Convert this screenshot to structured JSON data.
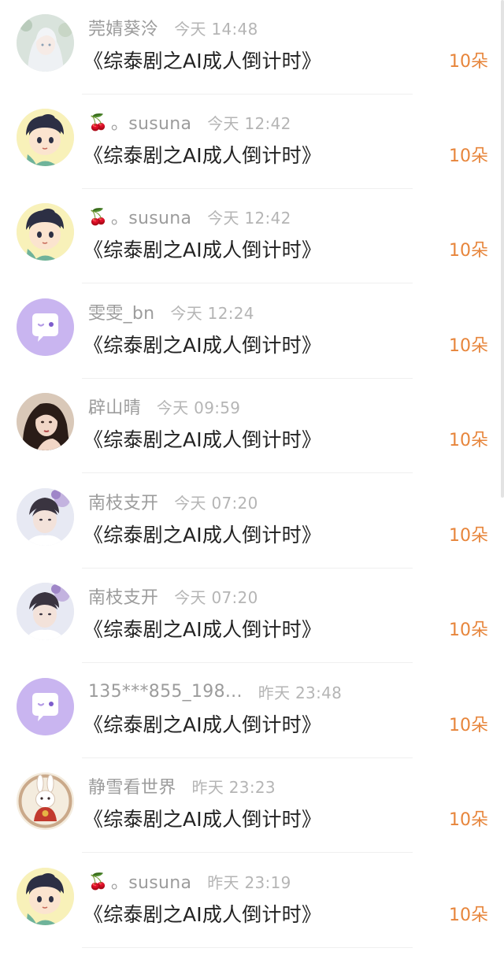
{
  "gift_list": {
    "items": [
      {
        "name": "莞婧葵泠",
        "name_emoji": "",
        "time": "今天 14:48",
        "title": "《综泰剧之AI成人倒计时》",
        "amount": "10朵",
        "avatar": "anime-girl-white-hair"
      },
      {
        "name": "。susuna",
        "name_emoji": "🍒",
        "time": "今天 12:42",
        "title": "《综泰剧之AI成人倒计时》",
        "amount": "10朵",
        "avatar": "cartoon-boy"
      },
      {
        "name": "。susuna",
        "name_emoji": "🍒",
        "time": "今天 12:42",
        "title": "《综泰剧之AI成人倒计时》",
        "amount": "10朵",
        "avatar": "cartoon-boy"
      },
      {
        "name": "雯雯_bn",
        "name_emoji": "",
        "time": "今天 12:24",
        "title": "《综泰剧之AI成人倒计时》",
        "amount": "10朵",
        "avatar": "default-chat-bubble"
      },
      {
        "name": "辟山晴",
        "name_emoji": "",
        "time": "今天 09:59",
        "title": "《综泰剧之AI成人倒计时》",
        "amount": "10朵",
        "avatar": "woman-photo"
      },
      {
        "name": "南枝支开",
        "name_emoji": "",
        "time": "今天 07:20",
        "title": "《综泰剧之AI成人倒计时》",
        "amount": "10朵",
        "avatar": "man-photo"
      },
      {
        "name": "南枝支开",
        "name_emoji": "",
        "time": "今天 07:20",
        "title": "《综泰剧之AI成人倒计时》",
        "amount": "10朵",
        "avatar": "man-photo"
      },
      {
        "name": "135***855_198...",
        "name_emoji": "",
        "time": "昨天 23:48",
        "title": "《综泰剧之AI成人倒计时》",
        "amount": "10朵",
        "avatar": "default-chat-bubble"
      },
      {
        "name": "静雪看世界",
        "name_emoji": "",
        "time": "昨天 23:23",
        "title": "《综泰剧之AI成人倒计时》",
        "amount": "10朵",
        "avatar": "cartoon-rabbit"
      },
      {
        "name": "。susuna",
        "name_emoji": "🍒",
        "time": "昨天 23:19",
        "title": "《综泰剧之AI成人倒计时》",
        "amount": "10朵",
        "avatar": "cartoon-boy"
      }
    ]
  },
  "colors": {
    "amount": "#e7853b",
    "name": "#9c9c9c",
    "time": "#b5b5b5",
    "title": "#222222",
    "default_avatar": "#c9b5f0"
  }
}
